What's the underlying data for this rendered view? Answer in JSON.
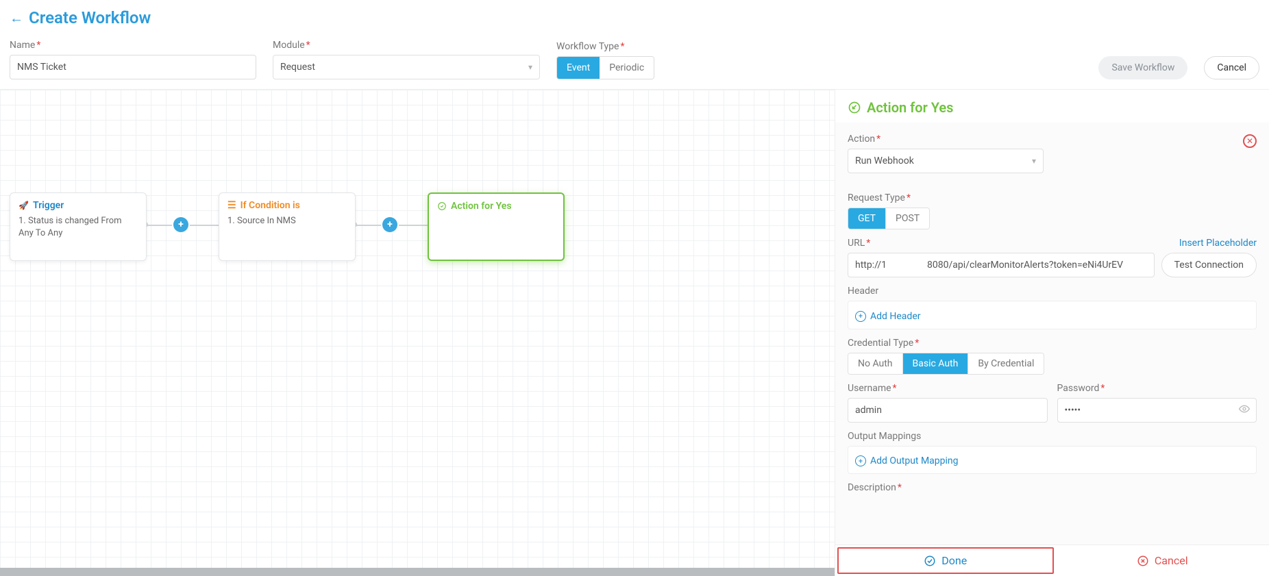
{
  "header": {
    "title": "Create Workflow",
    "name_label": "Name",
    "name_value": "NMS Ticket",
    "module_label": "Module",
    "module_value": "Request",
    "type_label": "Workflow Type",
    "type_options": [
      "Event",
      "Periodic"
    ],
    "type_selected": "Event",
    "save_label": "Save Workflow",
    "cancel_label": "Cancel"
  },
  "canvas": {
    "nodes": {
      "trigger": {
        "title": "Trigger",
        "line": "1. Status is changed From Any To Any",
        "icon": "rocket-icon"
      },
      "condition": {
        "title": "If Condition is",
        "line": "1. Source In NMS",
        "icon": "list-icon"
      },
      "action": {
        "title": "Action for Yes",
        "icon": "edit-icon"
      }
    }
  },
  "panel": {
    "title": "Action for Yes",
    "action_label": "Action",
    "action_value": "Run Webhook",
    "req_type_label": "Request Type",
    "req_type_options": [
      "GET",
      "POST"
    ],
    "req_type_selected": "GET",
    "url_label": "URL",
    "insert_ph": "Insert Placeholder",
    "url_value": "http://1                 8080/api/clearMonitorAlerts?token=eNi4UrEV",
    "test_conn": "Test Connection",
    "header_label": "Header",
    "add_header": "Add Header",
    "cred_label": "Credential Type",
    "cred_options": [
      "No Auth",
      "Basic Auth",
      "By Credential"
    ],
    "cred_selected": "Basic Auth",
    "user_label": "Username",
    "user_value": "admin",
    "pass_label": "Password",
    "pass_value": "•••••",
    "output_label": "Output Mappings",
    "add_output": "Add Output Mapping",
    "desc_label": "Description",
    "done": "Done",
    "cancel": "Cancel"
  }
}
